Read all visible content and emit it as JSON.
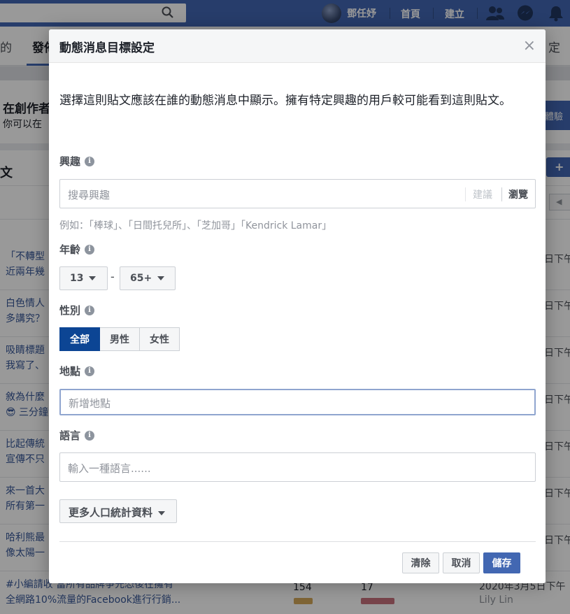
{
  "topbar": {
    "user_name": "鄧任妤",
    "home_label": "首頁",
    "create_label": "建立"
  },
  "page": {
    "tab_left_partial": "的",
    "tab_active_partial": "發佈",
    "tab_right_partial": "定",
    "creator_title_partial": "在創作者",
    "creator_sub_partial": "你可以在",
    "creator_button_partial": "體驗",
    "posts_title_partial": "文",
    "add_button_partial": "+ 新",
    "rows": [
      {
        "line1": "「不轉型",
        "line2": "近兩年幾",
        "date": "日下午"
      },
      {
        "line1": "白色情人",
        "line2": "多講究？",
        "date": "日下午"
      },
      {
        "line1": "吸睛標題",
        "line2": "我寫了、",
        "date": "日下午"
      },
      {
        "line1": "敘為什麼",
        "line2": "😎 三分鐘",
        "date": "日下午"
      },
      {
        "line1": "比起傳統",
        "line2": "宣傳不只",
        "date": "日下午"
      },
      {
        "line1": "來一首大",
        "line2": "所有第一",
        "date": "日下午"
      },
      {
        "line1": "哈利熊最",
        "line2": "像太陽一",
        "date": "日下午"
      }
    ],
    "last_row": {
      "line1": "#小編請收 當所有品牌爭先恐後在擁有",
      "line2": "全網路10%流量的Facebook進行行銷...",
      "value1": "154",
      "value2": "17",
      "date": "2020年3月5日下午",
      "author": "Lily Lin"
    }
  },
  "dialog": {
    "title": "動態消息目標設定",
    "close_glyph": "×",
    "description": "選擇這則貼文應該在誰的動態消息中顯示。擁有特定興趣的用戶較可能看到這則貼文。",
    "info_glyph": "i",
    "interests": {
      "label": "興趣",
      "placeholder": "搜尋興趣",
      "suggest_label": "建議",
      "browse_label": "瀏覽",
      "example": "例如：「棒球」、「日間托兒所」、「芝加哥」「Kendrick Lamar」"
    },
    "age": {
      "label": "年齡",
      "min": "13",
      "max": "65+",
      "separator": "-"
    },
    "gender": {
      "label": "性別",
      "options": [
        "全部",
        "男性",
        "女性"
      ],
      "selected": "全部"
    },
    "location": {
      "label": "地點",
      "placeholder": "新增地點"
    },
    "language": {
      "label": "語言",
      "placeholder": "輸入一種語言......"
    },
    "more_demographics": "更多人口統計資料",
    "buttons": {
      "clear": "清除",
      "cancel": "取消",
      "save": "儲存"
    }
  },
  "colors": {
    "brand_blue": "#4267b2",
    "selected_gender": "#0c4594"
  }
}
